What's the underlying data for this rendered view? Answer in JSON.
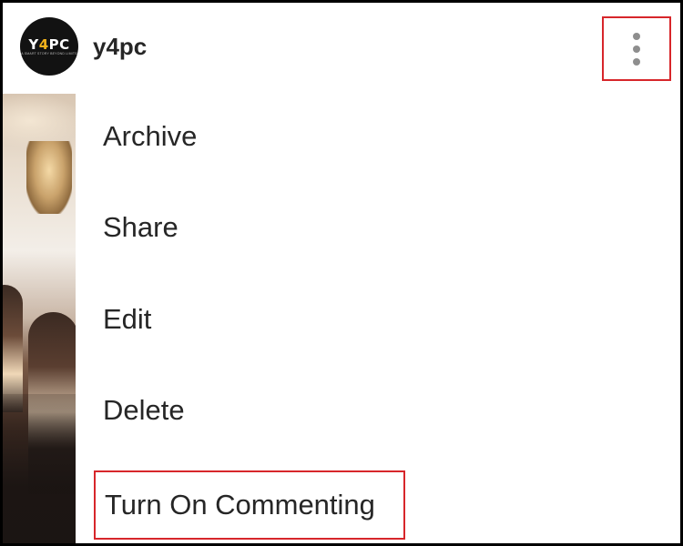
{
  "header": {
    "avatar": {
      "logo_prefix": "Y",
      "logo_accent": "4",
      "logo_suffix": "PC",
      "tagline": "A SMART STORY BEYOND LIMITS"
    },
    "username": "y4pc",
    "more_icon": "vertical-ellipsis-icon"
  },
  "menu": {
    "items": [
      {
        "label": "Archive"
      },
      {
        "label": "Share"
      },
      {
        "label": "Edit"
      },
      {
        "label": "Delete"
      },
      {
        "label": "Turn On Commenting"
      }
    ]
  },
  "colors": {
    "highlight_border": "#d7262b",
    "text": "#262626",
    "icon": "#8e8e8e",
    "logo_accent": "#f2b21b"
  }
}
